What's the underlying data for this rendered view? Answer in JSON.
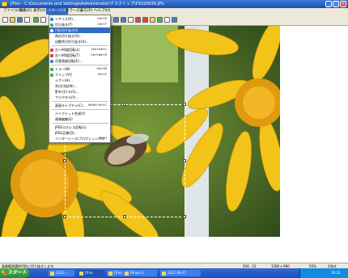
{
  "window": {
    "title": "JTrim - C:\\Documents and Settings\\Administrator\\デスクトップ\\P1020939.JPG",
    "minimize": "_",
    "maximize": "□",
    "close": "×"
  },
  "menubar": [
    {
      "label": "ファイル(F)"
    },
    {
      "label": "編集(E)"
    },
    {
      "label": "表示(V)"
    },
    {
      "label": "イメージ(I)"
    },
    {
      "label": "カラー(C)"
    },
    {
      "label": "加工(P)"
    },
    {
      "label": "ヘルプ(H)"
    }
  ],
  "menu": {
    "items": [
      {
        "label": "リサイズ(R)...",
        "shortcut": "Ctrl+R"
      },
      {
        "label": "切り抜き(T)",
        "shortcut": "Ctrl+T"
      },
      {
        "label": "円形切り抜き(I)",
        "shortcut": ""
      },
      {
        "label": "角丸切り抜き(D)...",
        "shortcut": ""
      },
      {
        "label": "自動余白切り抜き(A)...",
        "shortcut": ""
      },
      {
        "label": "左へ90度回転(L)",
        "shortcut": "Ctrl+Alt+L"
      },
      {
        "label": "右へ90度回転(T)",
        "shortcut": "Ctrl+Alt+R"
      },
      {
        "label": "任意角度回転(E)...",
        "shortcut": ""
      },
      {
        "label": "ミラー(M)",
        "shortcut": "Ctrl+M"
      },
      {
        "label": "フリップ(F)",
        "shortcut": "Ctrl+F"
      },
      {
        "label": "シフト(H)...",
        "shortcut": ""
      },
      {
        "label": "余白付加(W)...",
        "shortcut": ""
      },
      {
        "label": "影を付ける(S)...",
        "shortcut": ""
      },
      {
        "label": "フラクタル(Y)...",
        "shortcut": ""
      },
      {
        "label": "画面キャプチャ(C)...",
        "shortcut": "Shift+Ctrl+C"
      },
      {
        "label": "ハイブリッド合成(Y)",
        "shortcut": ""
      },
      {
        "label": "画像編集(E)",
        "shortcut": ""
      },
      {
        "label": "JPEGロスレス回転(L)",
        "shortcut": ""
      },
      {
        "label": "JPEG品質(Q)...",
        "shortcut": ""
      },
      {
        "label": "インターレース/プログレッシブ(I)",
        "shortcut": "Ctrl+I"
      },
      {
        "label": "画像情報(N)...",
        "shortcut": ""
      },
      {
        "label": "画像情報を表示(V)",
        "shortcut": ""
      }
    ]
  },
  "status": {
    "message": "画像範囲選択円形に切り抜きします。",
    "coords": "500 , 12",
    "size": "1280 x 960",
    "zoom": "50%",
    "depth": "24bit"
  },
  "taskbar": {
    "start_label": "スタート",
    "tasks": [
      {
        "label": "2011-..."
      },
      {
        "label": "JTrim"
      },
      {
        "label": "JTrim - ..."
      },
      {
        "label": "Picasa 3"
      },
      {
        "label": "2011-08-17"
      }
    ],
    "clock": "10:22"
  }
}
